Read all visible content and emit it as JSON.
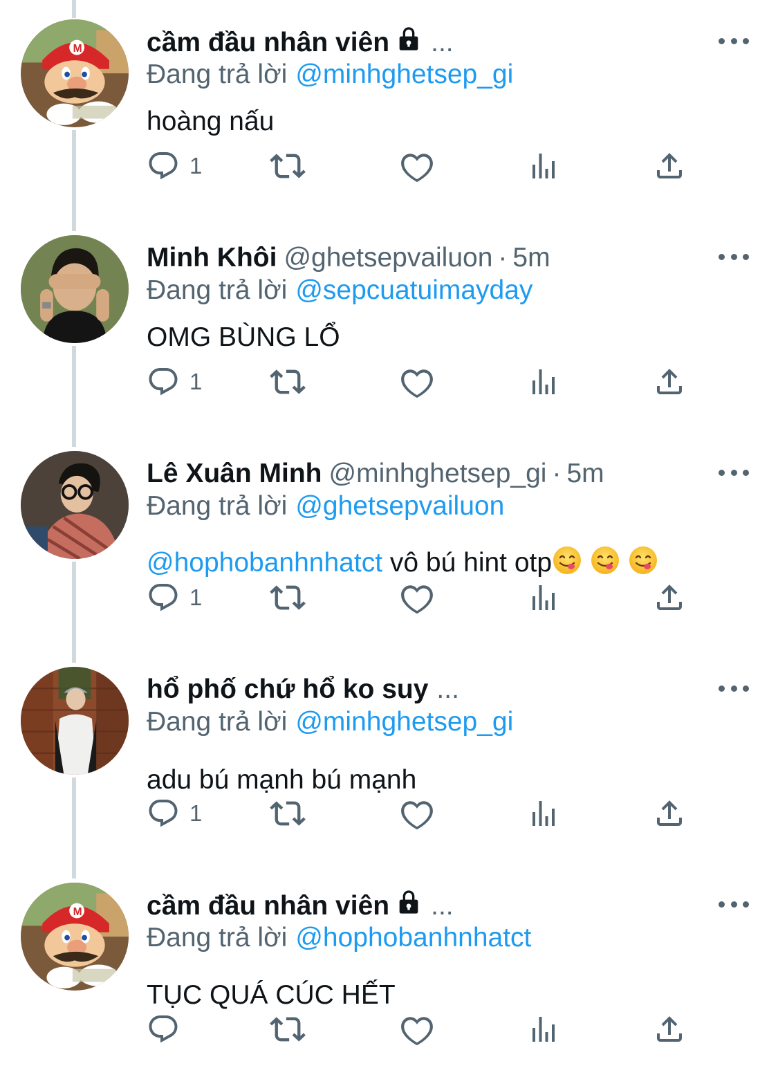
{
  "tweets": [
    {
      "name": "cầm đầu nhân viên",
      "locked": true,
      "ellipsis": "...",
      "handle": "",
      "time": "",
      "reply_prefix": "Đang trả lời",
      "reply_to": "@minhghetsep_gi",
      "mention": "",
      "text": "hoàng nấu",
      "emojis": 0,
      "reply_count": "1",
      "avatar": "mario-avatar"
    },
    {
      "name": "Minh Khôi",
      "locked": false,
      "ellipsis": "",
      "handle": "@ghetsepvailuon",
      "time": "5m",
      "reply_prefix": "Đang trả lời",
      "reply_to": "@sepcuatuimayday",
      "mention": "",
      "text": "OMG BÙNG LỔ",
      "emojis": 0,
      "reply_count": "1",
      "avatar": "person-covering-eyes-avatar"
    },
    {
      "name": "Lê Xuân Minh",
      "locked": false,
      "ellipsis": "",
      "handle": "@minhghetsep_gi",
      "time": "5m",
      "reply_prefix": "Đang trả lời",
      "reply_to": "@ghetsepvailuon",
      "mention": "@hophobanhnhatct",
      "text": "vô bú hint otp",
      "emojis": 3,
      "reply_count": "1",
      "avatar": "person-glasses-avatar"
    },
    {
      "name": "hổ phố chứ hổ ko suy",
      "locked": false,
      "ellipsis": "...",
      "handle": "",
      "time": "",
      "reply_prefix": "Đang trả lời",
      "reply_to": "@minhghetsep_gi",
      "mention": "",
      "text": "adu bú mạnh bú mạnh",
      "emojis": 0,
      "reply_count": "1",
      "avatar": "person-cap-avatar"
    },
    {
      "name": "cầm đầu nhân viên",
      "locked": true,
      "ellipsis": "...",
      "handle": "",
      "time": "",
      "reply_prefix": "Đang trả lời",
      "reply_to": "@hophobanhnhatct",
      "mention": "",
      "text": "TỤC QUÁ CÚC HẾT",
      "emojis": 0,
      "reply_count": "",
      "avatar": "mario-avatar"
    }
  ],
  "colors": {
    "text": "#0f1419",
    "secondary": "#536471",
    "link": "#1d9bf0",
    "thread_line": "#cfd9de"
  }
}
